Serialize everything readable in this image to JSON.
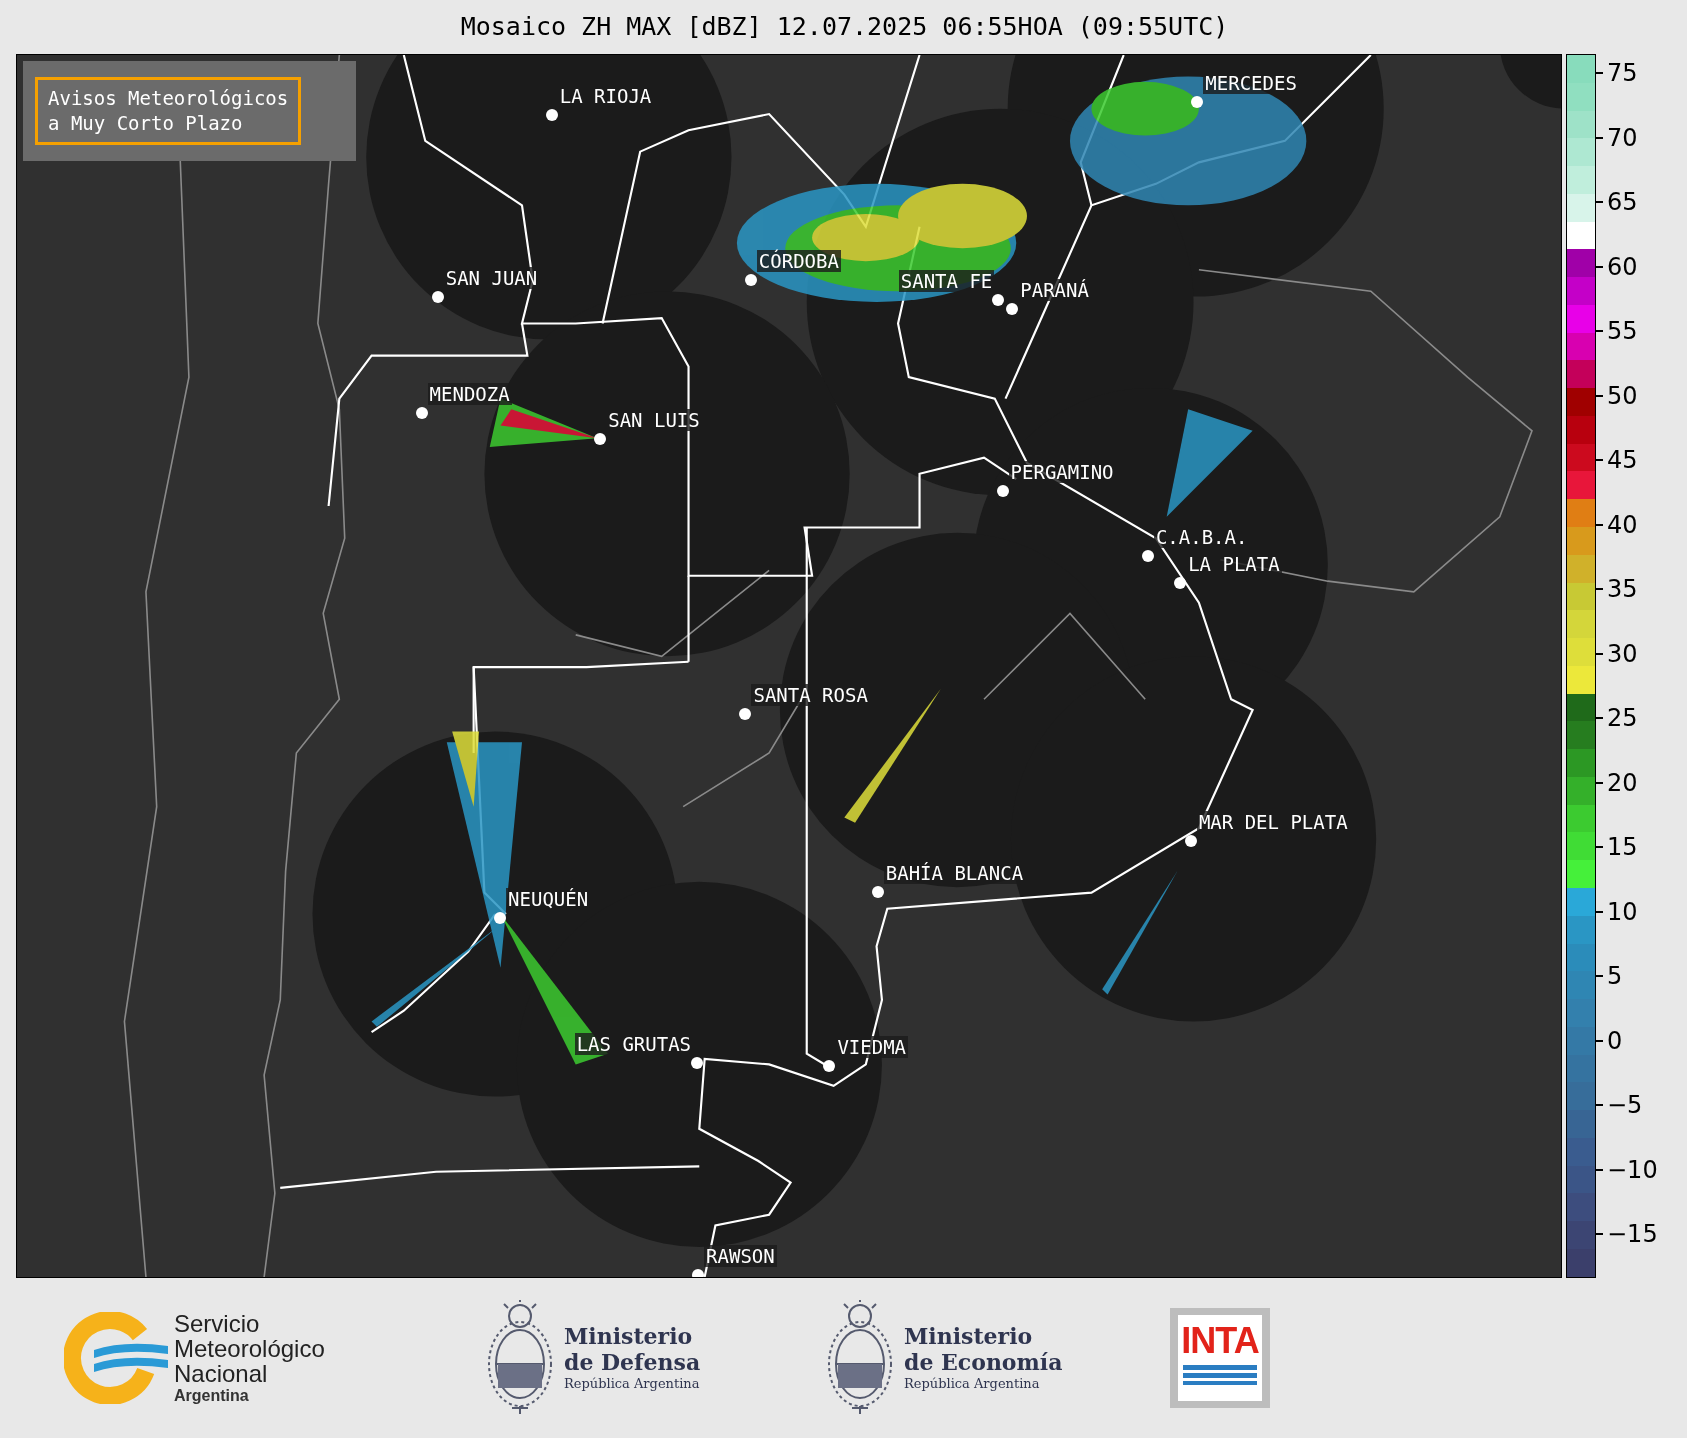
{
  "title": "Mosaico ZH MAX [dBZ] 12.07.2025 06:55HOA (09:55UTC)",
  "notice": {
    "lines": [
      "Avisos Meteorológicos",
      "a Muy Corto Plazo"
    ]
  },
  "cities": [
    {
      "name": "LA RIOJA"
    },
    {
      "name": "MERCEDES"
    },
    {
      "name": "SAN JUAN"
    },
    {
      "name": "CÓRDOBA"
    },
    {
      "name": "SANTA FE"
    },
    {
      "name": "PARANÁ"
    },
    {
      "name": "MENDOZA"
    },
    {
      "name": "SAN LUIS"
    },
    {
      "name": "PERGAMINO"
    },
    {
      "name": "C.A.B.A."
    },
    {
      "name": "LA PLATA"
    },
    {
      "name": "SANTA ROSA"
    },
    {
      "name": "MAR DEL PLATA"
    },
    {
      "name": "BAHÍA BLANCA"
    },
    {
      "name": "NEUQUÉN"
    },
    {
      "name": "LAS GRUTAS"
    },
    {
      "name": "VIEDMA"
    },
    {
      "name": "RAWSON"
    }
  ],
  "colorbar": {
    "ticks": [
      "75",
      "70",
      "65",
      "60",
      "55",
      "50",
      "45",
      "40",
      "35",
      "30",
      "25",
      "20",
      "15",
      "10",
      "5",
      "0",
      "−5",
      "−10",
      "−15"
    ],
    "bands": [
      {
        "color": "#88dcbc"
      },
      {
        "color": "#90dfc0"
      },
      {
        "color": "#9ee2c8"
      },
      {
        "color": "#aee8d2"
      },
      {
        "color": "#c0eedc"
      },
      {
        "color": "#d8f4ea"
      },
      {
        "color": "#ffffff"
      },
      {
        "color": "#a000a8"
      },
      {
        "color": "#c400c8"
      },
      {
        "color": "#e800e8"
      },
      {
        "color": "#d800b0"
      },
      {
        "color": "#c4005a"
      },
      {
        "color": "#a00000"
      },
      {
        "color": "#b8000e"
      },
      {
        "color": "#cc0a1e"
      },
      {
        "color": "#e8163a"
      },
      {
        "color": "#e07e14"
      },
      {
        "color": "#d89a1c"
      },
      {
        "color": "#d0b12a"
      },
      {
        "color": "#c8c934"
      },
      {
        "color": "#d4d63a"
      },
      {
        "color": "#dede3a"
      },
      {
        "color": "#ece83a"
      },
      {
        "color": "#1f6a1a"
      },
      {
        "color": "#267d1f"
      },
      {
        "color": "#2c9824"
      },
      {
        "color": "#34b02a"
      },
      {
        "color": "#3ccb30"
      },
      {
        "color": "#40dc35"
      },
      {
        "color": "#45f03a"
      },
      {
        "color": "#2aa8d8"
      },
      {
        "color": "#2a96c4"
      },
      {
        "color": "#2b8cba"
      },
      {
        "color": "#2f86b3"
      },
      {
        "color": "#3380ad"
      },
      {
        "color": "#3479a6"
      },
      {
        "color": "#3573a0"
      },
      {
        "color": "#376d9a"
      },
      {
        "color": "#386594"
      },
      {
        "color": "#3a5c8f"
      },
      {
        "color": "#3b5587"
      },
      {
        "color": "#3d4d7e"
      },
      {
        "color": "#3c4573"
      },
      {
        "color": "#3b3f6b"
      }
    ]
  },
  "footer": {
    "smn": {
      "lines": [
        "Servicio",
        "Meteorológico",
        "Nacional"
      ],
      "country": "Argentina"
    },
    "ministries": [
      {
        "name": "Ministerio",
        "branch": "de Defensa",
        "country": "República Argentina"
      },
      {
        "name": "Ministerio",
        "branch": "de Economía",
        "country": "República Argentina"
      }
    ],
    "inta": {
      "label": "INTA"
    }
  }
}
